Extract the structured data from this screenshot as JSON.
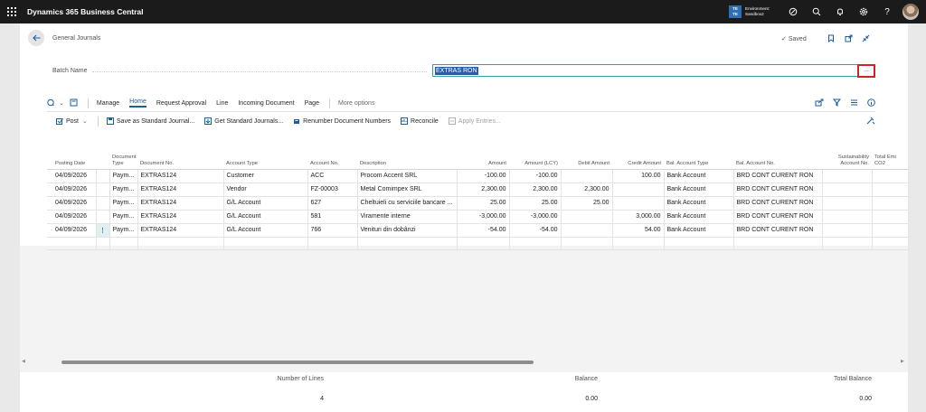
{
  "app": {
    "title": "Dynamics 365 Business Central"
  },
  "environment": {
    "badge": "TE\nTE",
    "label": "Environment:\nSandbox2"
  },
  "page": {
    "breadcrumb": "General Journals",
    "saved_label": "Saved"
  },
  "batch": {
    "label": "Batch Name",
    "value": "EXTRAS RON",
    "lookup": "..."
  },
  "actionbar": {
    "items": [
      "Manage",
      "Home",
      "Request Approval",
      "Line",
      "Incoming Document",
      "Page"
    ],
    "more": "More options"
  },
  "toolbar": {
    "post": "Post",
    "save_standard": "Save as Standard Journal...",
    "get_standard": "Get Standard Journals...",
    "renumber": "Renumber Document Numbers",
    "reconcile": "Reconcile",
    "apply_entries": "Apply Entries..."
  },
  "grid": {
    "columns": [
      "Posting Date",
      "",
      "Document Type",
      "Document No.",
      "Account Type",
      "Account No.",
      "Description",
      "Amount",
      "Amount (LCY)",
      "Debit Amount",
      "Credit Amount",
      "Bal. Account Type",
      "Bal. Account No.",
      "Sustainability Account No.",
      "Total Emi CO2"
    ],
    "rows": [
      {
        "posting_date": "04/09/2026",
        "doc_type": "Paym...",
        "doc_no": "EXTRAS124",
        "account_type": "Customer",
        "account_no": "ACC",
        "description": "Procom Accent SRL",
        "amount": "-100.00",
        "amount_lcy": "-100.00",
        "debit": "",
        "credit": "100.00",
        "bal_type": "Bank Account",
        "bal_no": "BRD CONT CURENT RON"
      },
      {
        "posting_date": "04/09/2026",
        "doc_type": "Paym...",
        "doc_no": "EXTRAS124",
        "account_type": "Vendor",
        "account_no": "FZ-00003",
        "description": "Metal Comimpex SRL",
        "amount": "2,300.00",
        "amount_lcy": "2,300.00",
        "debit": "2,300.00",
        "credit": "",
        "bal_type": "Bank Account",
        "bal_no": "BRD CONT CURENT RON"
      },
      {
        "posting_date": "04/09/2026",
        "doc_type": "Paym...",
        "doc_no": "EXTRAS124",
        "account_type": "G/L Account",
        "account_no": "627",
        "description": "Cheltuieli cu serviciile bancare ...",
        "amount": "25.00",
        "amount_lcy": "25.00",
        "debit": "25.00",
        "credit": "",
        "bal_type": "Bank Account",
        "bal_no": "BRD CONT CURENT RON"
      },
      {
        "posting_date": "04/09/2026",
        "doc_type": "Paym...",
        "doc_no": "EXTRAS124",
        "account_type": "G/L Account",
        "account_no": "581",
        "description": "Viramente interne",
        "amount": "-3,000.00",
        "amount_lcy": "-3,000.00",
        "debit": "",
        "credit": "3,000.00",
        "bal_type": "Bank Account",
        "bal_no": "BRD CONT CURENT RON"
      },
      {
        "posting_date": "04/09/2026",
        "doc_type": "Paym...",
        "doc_no": "EXTRAS124",
        "account_type": "G/L Account",
        "account_no": "766",
        "description": "Venituri din dobânzi",
        "amount": "-54.00",
        "amount_lcy": "-54.00",
        "debit": "",
        "credit": "54.00",
        "bal_type": "Bank Account",
        "bal_no": "BRD CONT CURENT RON"
      }
    ],
    "current_row_marker": "→",
    "row_menu": "⋮"
  },
  "footer": {
    "number_of_lines_label": "Number of Lines",
    "number_of_lines": "4",
    "balance_label": "Balance",
    "balance": "0.00",
    "total_balance_label": "Total Balance",
    "total_balance": "0.00"
  },
  "colors": {
    "accent": "#1b5e9b",
    "selection": "#2b5ca8",
    "highlight_border": "#c62828"
  }
}
